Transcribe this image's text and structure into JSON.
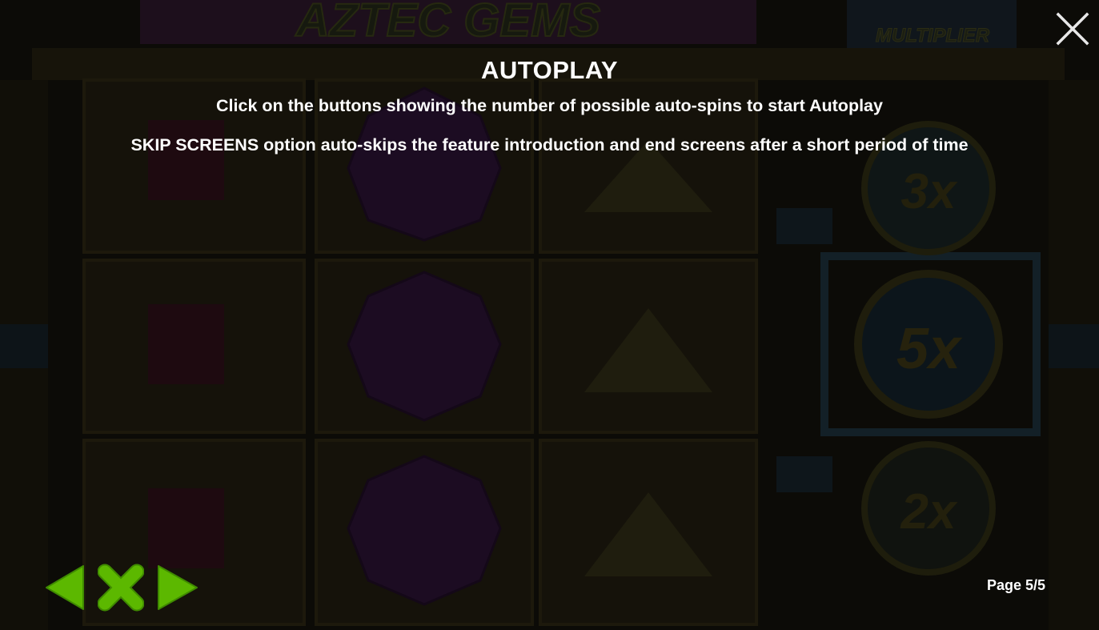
{
  "background": {
    "game_logo_text": "AZTEC GEMS",
    "multiplier_banner_text": "MULTIPLIER",
    "multiplier_values": [
      "3x",
      "5x",
      "2x"
    ]
  },
  "help_page": {
    "title": "AUTOPLAY",
    "lines": [
      "Click on the buttons showing the number of possible auto-spins to start Autoplay",
      "SKIP SCREENS option auto-skips the feature introduction and end screens after a short period of time"
    ],
    "page_indicator": "Page 5/5"
  },
  "navigation": {
    "prev_icon": "arrow-left-icon",
    "exit_icon": "x-icon",
    "next_icon": "arrow-right-icon",
    "close_icon": "close-icon"
  },
  "colors": {
    "text": "#ffffff",
    "nav_green": "#5cb800",
    "nav_green_dark": "#3f8a00"
  }
}
